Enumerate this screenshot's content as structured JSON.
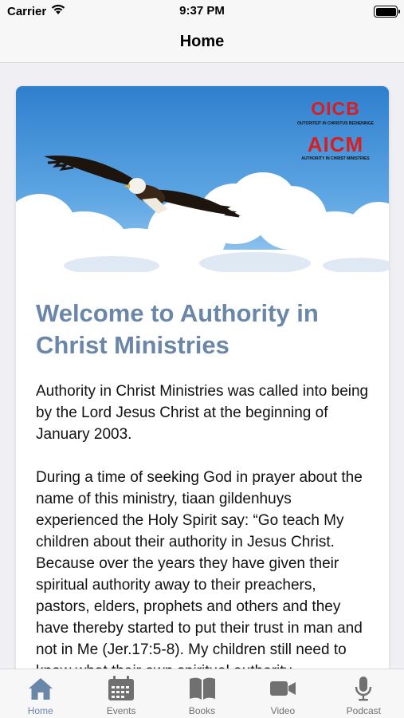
{
  "status_bar": {
    "carrier": "Carrier",
    "time": "9:37 PM"
  },
  "nav": {
    "title": "Home"
  },
  "banner": {
    "brand_oicb": "OICB",
    "brand_oicb_sub": "OUTORITEIT IN CHRISTUS BEDIENINGE",
    "brand_aicm": "AICM",
    "brand_aicm_sub": "AUTHORITY IN CHRIST MINISTRIES"
  },
  "article": {
    "heading": "Welcome to Authority in Christ Ministries",
    "paragraphs": [
      "Authority in Christ Ministries was called into being by the Lord Jesus Christ at the beginning of January 2003.",
      "During a time of seeking God in prayer about the name of this ministry, tiaan gildenhuys experienced the Holy Spirit say: “Go teach My children about their authority in Jesus Christ. Because over the years they have given their spiritual authority away to their preachers, pastors, elders, prophets and others and they have thereby started to put their trust in man and not in Me (Jer.17:5-8). My children still need to know what their own spiritual authority"
    ]
  },
  "tabs": [
    {
      "label": "Home",
      "icon": "home-icon",
      "active": true
    },
    {
      "label": "Events",
      "icon": "calendar-icon",
      "active": false
    },
    {
      "label": "Books",
      "icon": "book-icon",
      "active": false
    },
    {
      "label": "Video",
      "icon": "video-camera-icon",
      "active": false
    },
    {
      "label": "Podcast",
      "icon": "microphone-icon",
      "active": false
    }
  ],
  "colors": {
    "accent": "#6a86a8",
    "brand_red": "#d91e1e",
    "inactive_icon": "#707070"
  }
}
